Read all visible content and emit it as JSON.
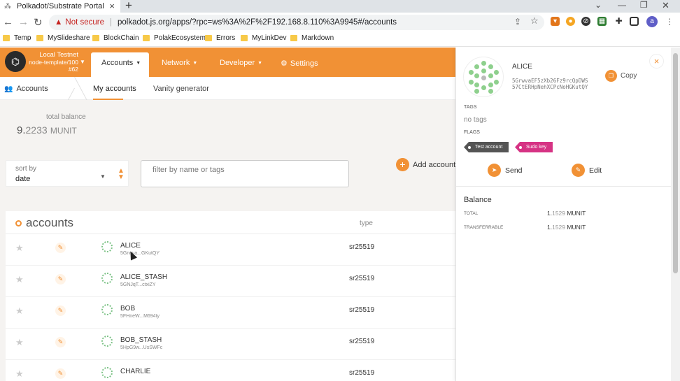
{
  "browser": {
    "tab_title": "Polkadot/Substrate Portal",
    "tab_close": "×",
    "new_tab": "+",
    "url_warning": "Not secure",
    "url": "polkadot.js.org/apps/?rpc=ws%3A%2F%2F192.168.8.110%3A9945#/accounts",
    "bookmarks": [
      "Temp",
      "MySlideshare",
      "BlockChain",
      "PolakEcosystem",
      "Errors",
      "MyLinkDev",
      "Markdown"
    ],
    "profile_initial": "a"
  },
  "chain": {
    "name": "Local Testnet",
    "node": "node-template/100",
    "block": "#62"
  },
  "nav": {
    "accounts": "Accounts",
    "network": "Network",
    "developer": "Developer",
    "settings": "Settings"
  },
  "subnav": {
    "section": "Accounts",
    "tabs": [
      "My accounts",
      "Vanity generator"
    ]
  },
  "summary": {
    "total_label": "total balance",
    "total_int": "9.",
    "total_dec": "2233",
    "unit": "MUNIT"
  },
  "controls": {
    "sort_label": "sort by",
    "sort_value": "date",
    "filter_placeholder": "filter by name or tags",
    "add_account": "Add account"
  },
  "table": {
    "title": "accounts",
    "type_header": "type",
    "rows": [
      {
        "name": "ALICE",
        "address": "5Grwva...GKutQY",
        "type": "sr25519"
      },
      {
        "name": "ALICE_STASH",
        "address": "5GNJqT...ctxiZY",
        "type": "sr25519"
      },
      {
        "name": "BOB",
        "address": "5FHneW...M694ty",
        "type": "sr25519"
      },
      {
        "name": "BOB_STASH",
        "address": "5HpG9w...UsSWFc",
        "type": "sr25519"
      },
      {
        "name": "CHARLIE",
        "address": "",
        "type": "sr25519"
      }
    ]
  },
  "sidebar": {
    "name": "ALICE",
    "address_line1": "5GrwvaEF5zXb26Fz9rcQpDWS",
    "address_line2": "57CtERHpNehXCPcNoHGKutQY",
    "copy": "Copy",
    "close": "×",
    "tags_label": "TAGS",
    "no_tags": "no tags",
    "flags_label": "FLAGS",
    "flag_test": "Test account",
    "flag_sudo": "Sudo key",
    "send": "Send",
    "edit": "Edit",
    "balance_title": "Balance",
    "total_label": "TOTAL",
    "total_int": "1.",
    "total_dec": "1529",
    "transferrable_label": "TRANSFERRABLE",
    "transferrable_int": "1.",
    "transferrable_dec": "1529",
    "unit": "MUNIT"
  },
  "colors": {
    "accent": "#f19135",
    "sudo": "#d63384",
    "test": "#555555"
  }
}
